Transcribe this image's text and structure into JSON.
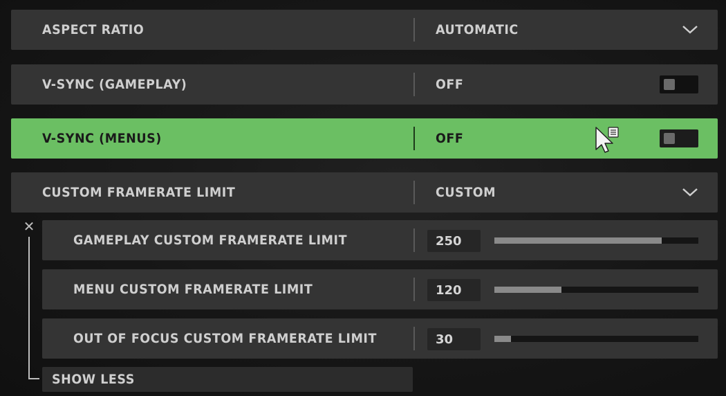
{
  "settings": {
    "aspect_ratio": {
      "label": "ASPECT RATIO",
      "value": "AUTOMATIC"
    },
    "vsync_gameplay": {
      "label": "V-SYNC (GAMEPLAY)",
      "value": "OFF"
    },
    "vsync_menus": {
      "label": "V-SYNC (MENUS)",
      "value": "OFF"
    },
    "custom_framerate": {
      "label": "CUSTOM FRAMERATE LIMIT",
      "value": "CUSTOM"
    },
    "gameplay_limit": {
      "label": "GAMEPLAY CUSTOM FRAMERATE LIMIT",
      "value": "250",
      "slider_fraction": 0.82
    },
    "menu_limit": {
      "label": "MENU CUSTOM FRAMERATE LIMIT",
      "value": "120",
      "slider_fraction": 0.33
    },
    "out_of_focus_limit": {
      "label": "OUT OF FOCUS CUSTOM FRAMERATE LIMIT",
      "value": "30",
      "slider_fraction": 0.08
    }
  },
  "show_less_label": "SHOW LESS",
  "collapse_symbol": "✕",
  "colors": {
    "highlight": "#6bbf63",
    "row_background": "#343434",
    "text": "#cfcfcf"
  },
  "icons": {
    "dropdown": "chevron-down-icon",
    "cursor": "mouse-pointer-icon",
    "collapse": "close-icon"
  }
}
